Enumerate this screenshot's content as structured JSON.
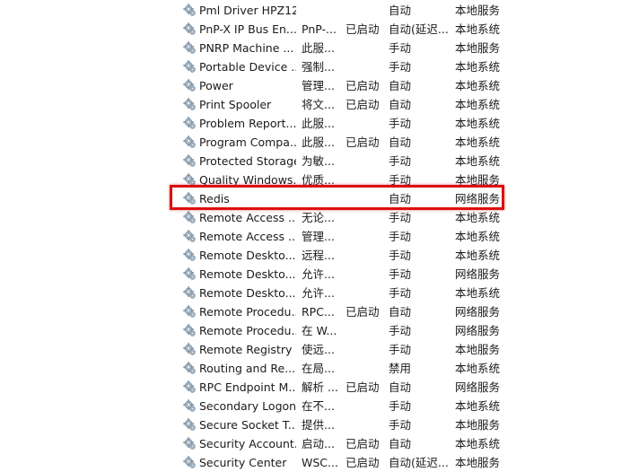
{
  "services": [
    {
      "name": "Pml Driver HPZ12",
      "description": "",
      "status": "",
      "startup": "自动",
      "logon": "本地服务"
    },
    {
      "name": "PnP-X IP Bus En...",
      "description": "PnP-...",
      "status": "已启动",
      "startup": "自动(延迟...",
      "logon": "本地系统"
    },
    {
      "name": "PNRP Machine ...",
      "description": "此服...",
      "status": "",
      "startup": "手动",
      "logon": "本地服务"
    },
    {
      "name": "Portable Device ...",
      "description": "强制...",
      "status": "",
      "startup": "手动",
      "logon": "本地系统"
    },
    {
      "name": "Power",
      "description": "管理...",
      "status": "已启动",
      "startup": "自动",
      "logon": "本地系统"
    },
    {
      "name": "Print Spooler",
      "description": "将文...",
      "status": "已启动",
      "startup": "自动",
      "logon": "本地系统"
    },
    {
      "name": "Problem Report...",
      "description": "此服...",
      "status": "",
      "startup": "手动",
      "logon": "本地系统"
    },
    {
      "name": "Program Compa...",
      "description": "此服...",
      "status": "已启动",
      "startup": "自动",
      "logon": "本地系统"
    },
    {
      "name": "Protected Storage",
      "description": "为敏...",
      "status": "",
      "startup": "手动",
      "logon": "本地系统"
    },
    {
      "name": "Quality Windows...",
      "description": "优质...",
      "status": "",
      "startup": "手动",
      "logon": "本地服务"
    },
    {
      "name": "Redis",
      "description": "",
      "status": "",
      "startup": "自动",
      "logon": "网络服务"
    },
    {
      "name": "Remote Access ...",
      "description": "无论...",
      "status": "",
      "startup": "手动",
      "logon": "本地系统"
    },
    {
      "name": "Remote Access ...",
      "description": "管理...",
      "status": "",
      "startup": "手动",
      "logon": "本地系统"
    },
    {
      "name": "Remote Deskto...",
      "description": "远程...",
      "status": "",
      "startup": "手动",
      "logon": "本地系统"
    },
    {
      "name": "Remote Deskto...",
      "description": "允许...",
      "status": "",
      "startup": "手动",
      "logon": "网络服务"
    },
    {
      "name": "Remote Deskto...",
      "description": "允许...",
      "status": "",
      "startup": "手动",
      "logon": "本地系统"
    },
    {
      "name": "Remote Procedu...",
      "description": "RPC...",
      "status": "已启动",
      "startup": "自动",
      "logon": "网络服务"
    },
    {
      "name": "Remote Procedu...",
      "description": "在 W...",
      "status": "",
      "startup": "手动",
      "logon": "网络服务"
    },
    {
      "name": "Remote Registry",
      "description": "使远...",
      "status": "",
      "startup": "手动",
      "logon": "本地服务"
    },
    {
      "name": "Routing and Re...",
      "description": "在局...",
      "status": "",
      "startup": "禁用",
      "logon": "本地系统"
    },
    {
      "name": "RPC Endpoint M...",
      "description": "解析 ...",
      "status": "已启动",
      "startup": "自动",
      "logon": "网络服务"
    },
    {
      "name": "Secondary Logon",
      "description": "在不...",
      "status": "",
      "startup": "手动",
      "logon": "本地系统"
    },
    {
      "name": "Secure Socket T...",
      "description": "提供...",
      "status": "",
      "startup": "手动",
      "logon": "本地服务"
    },
    {
      "name": "Security Account...",
      "description": "启动...",
      "status": "已启动",
      "startup": "自动",
      "logon": "本地系统"
    },
    {
      "name": "Security Center",
      "description": "WSC...",
      "status": "已启动",
      "startup": "自动(延迟...",
      "logon": "本地服务"
    }
  ],
  "highlight": {
    "color": "#dd0f0f",
    "service_index": 10
  },
  "icon": "gear-service-icon"
}
